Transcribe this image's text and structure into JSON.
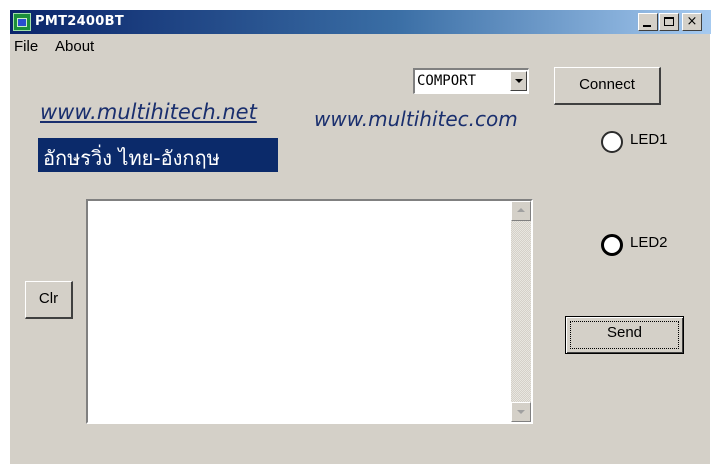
{
  "window": {
    "title": "PMT2400BT",
    "icon": "app-icon",
    "controls": {
      "minimize": "minimize-icon",
      "maximize": "maximize-icon",
      "close": "close-icon",
      "close_glyph": "×"
    }
  },
  "menu": {
    "items": [
      {
        "label": "File"
      },
      {
        "label": "About"
      }
    ]
  },
  "port_select": {
    "value": "COMPORT"
  },
  "buttons": {
    "connect": "Connect",
    "clear": "Clr",
    "send": "Send"
  },
  "branding": {
    "link1": "www.multihitech.net",
    "link2": "www.multihitec.com",
    "thai_banner": "อักษรวิ่ง ไทย-อังกฤษ"
  },
  "leds": [
    {
      "label": "LED1"
    },
    {
      "label": "LED2"
    }
  ],
  "memo": {
    "text": ""
  },
  "colors": {
    "face": "#d4d0c8",
    "title_bar_start": "#0a246a",
    "banner": "#0b2a6a",
    "link": "#1a2f6e"
  }
}
